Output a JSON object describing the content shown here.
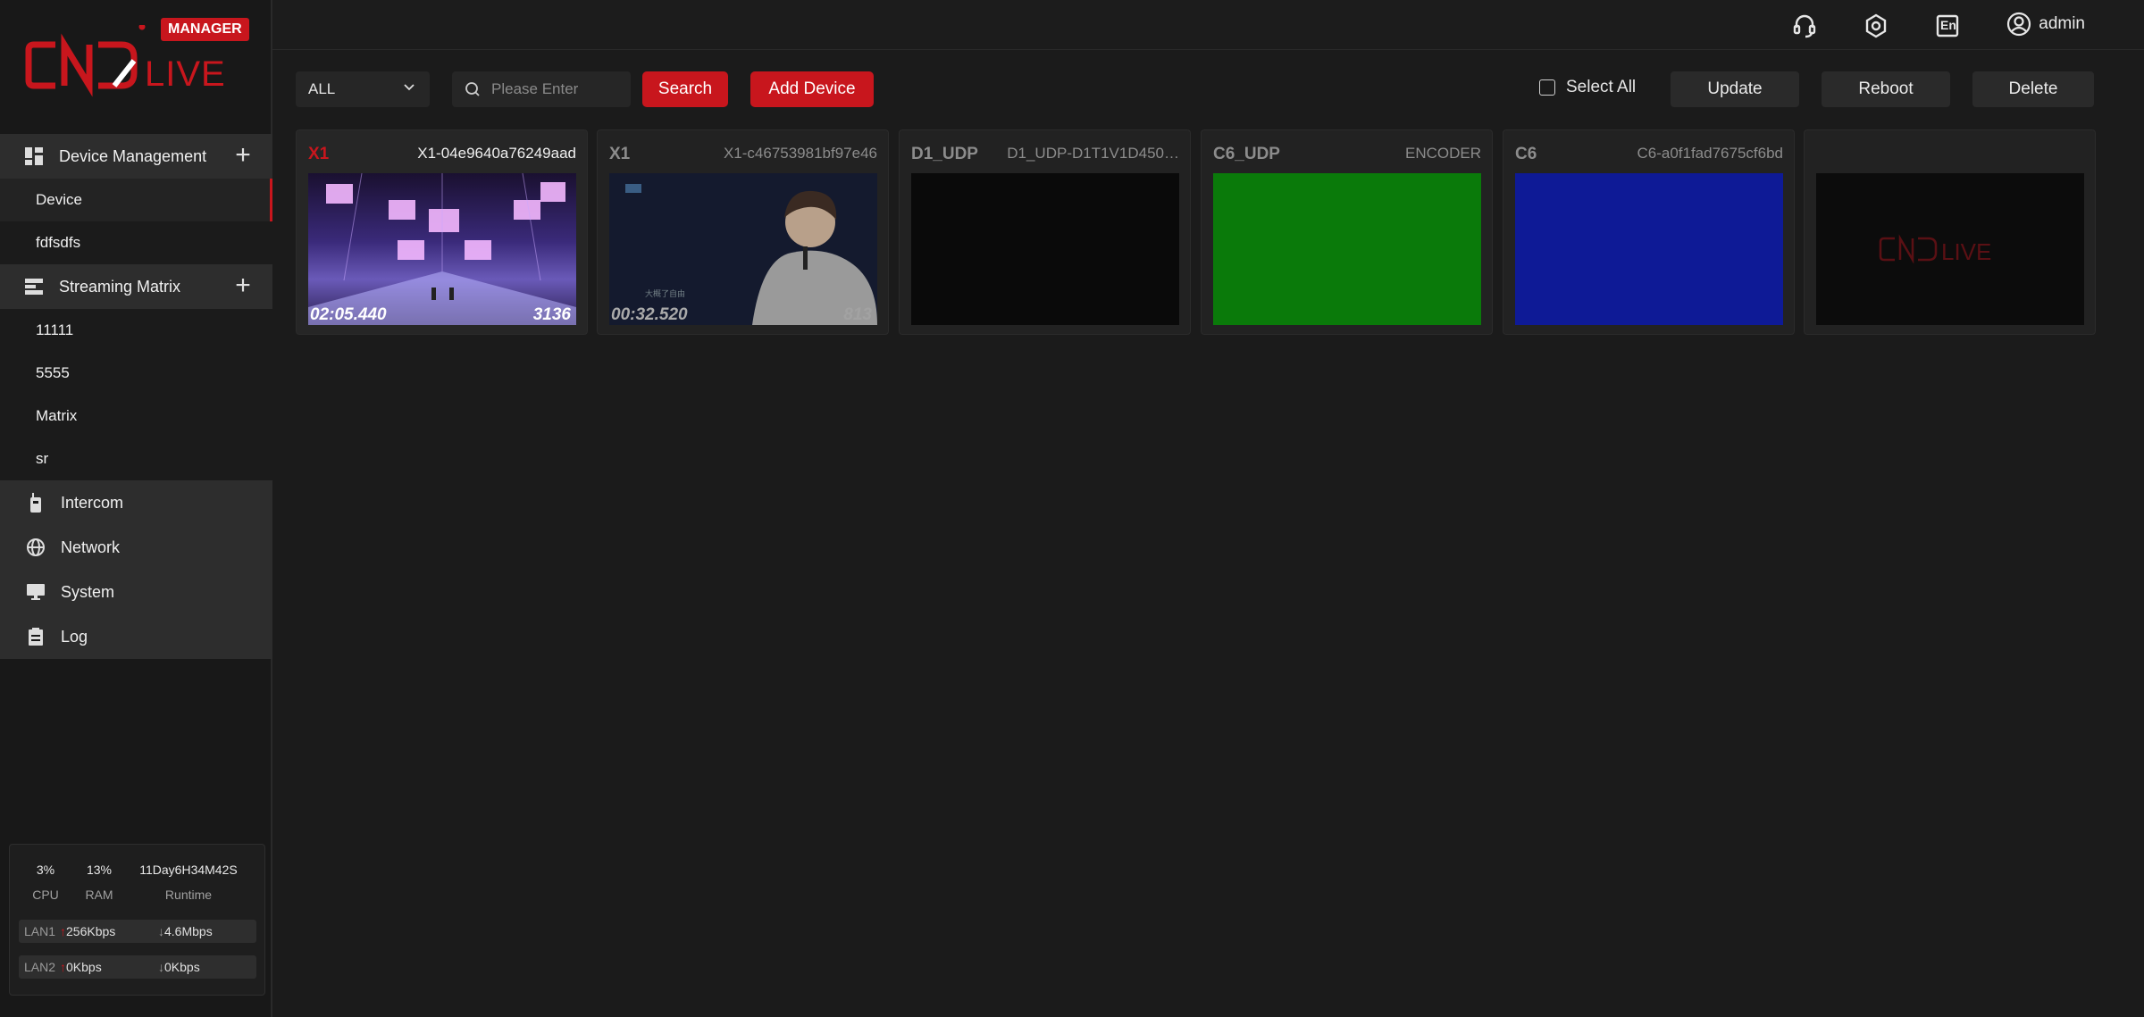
{
  "brand": {
    "badge": "MANAGER",
    "logo_text": "CNDLIVE",
    "accent": "#c8161d"
  },
  "sidebar": {
    "groups": [
      {
        "label": "Device Management",
        "items": [
          "Device",
          "fdfsdfs"
        ]
      },
      {
        "label": "Streaming Matrix",
        "items": [
          "11111",
          "5555",
          "Matrix",
          "sr"
        ]
      }
    ],
    "plain": [
      "Intercom",
      "Network",
      "System",
      "Log"
    ],
    "active_item": "Device"
  },
  "stats": {
    "cpu": {
      "value": "3%",
      "label": "CPU"
    },
    "ram": {
      "value": "13%",
      "label": "RAM"
    },
    "runtime": {
      "value": "11Day6H34M42S",
      "label": "Runtime"
    },
    "lan": [
      {
        "name": "LAN1",
        "up": "256Kbps",
        "down": "4.6Mbps"
      },
      {
        "name": "LAN2",
        "up": "0Kbps",
        "down": "0Kbps"
      }
    ]
  },
  "topbar": {
    "lang": "En",
    "user": "admin"
  },
  "toolbar": {
    "filter_value": "ALL",
    "search_placeholder": "Please Enter",
    "search_label": "Search",
    "add_label": "Add Device",
    "select_all_label": "Select All",
    "update_label": "Update",
    "reboot_label": "Reboot",
    "delete_label": "Delete"
  },
  "devices": [
    {
      "name": "X1",
      "id": "X1-04e9640a76249aad",
      "time": "02:05.440",
      "count": "3136",
      "preview": "concert-stage",
      "selected": true
    },
    {
      "name": "X1",
      "id": "X1-c46753981bf97e46",
      "time": "00:32.520",
      "count": "813",
      "preview": "singer",
      "selected": false
    },
    {
      "name": "D1_UDP",
      "id": "D1_UDP-D1T1V1D450…",
      "time": "",
      "count": "",
      "preview": "black",
      "selected": false
    },
    {
      "name": "C6_UDP",
      "id": "ENCODER",
      "time": "",
      "count": "",
      "preview": "#0a7a0a",
      "selected": false
    },
    {
      "name": "C6",
      "id": "C6-a0f1fad7675cf6bd",
      "time": "",
      "count": "",
      "preview": "#0e1a96",
      "selected": false
    },
    {
      "name": "",
      "id": "",
      "time": "",
      "count": "",
      "preview": "logo",
      "selected": false
    }
  ]
}
